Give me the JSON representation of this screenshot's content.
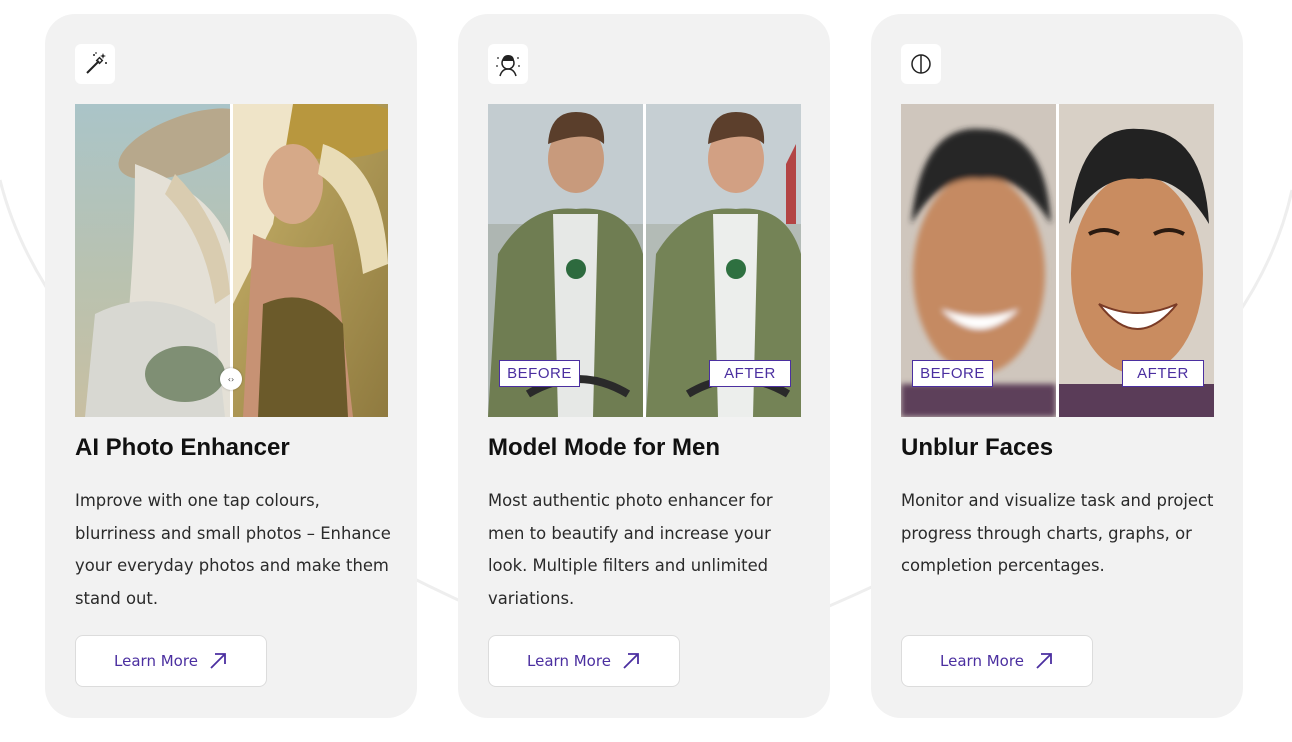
{
  "colors": {
    "card_bg": "#f2f2f2",
    "accent": "#4b2fa0",
    "title": "#111111",
    "text": "#2a2a2a"
  },
  "cards": [
    {
      "icon": "magic-wand-icon",
      "title": "AI Photo Enhancer",
      "description": "Improve with one tap colours, blurriness and small photos – Enhance your everyday photos and make them stand out.",
      "button_label": "Learn More",
      "button_icon": "arrow-up-right-icon",
      "compare_style": "slider",
      "slider_handle_glyph": "‹›"
    },
    {
      "icon": "man-portrait-icon",
      "title": "Model Mode for Men",
      "description": "Most authentic photo enhancer for men to beautify and increase your look. Multiple filters and unlimited variations.",
      "button_label": "Learn More",
      "button_icon": "arrow-up-right-icon",
      "before_label": "BEFORE",
      "after_label": "AFTER"
    },
    {
      "icon": "half-circle-icon",
      "title": "Unblur Faces",
      "description": "Monitor and visualize task and project progress through charts, graphs, or completion percentages.",
      "button_label": "Learn More",
      "button_icon": "arrow-up-right-icon",
      "before_label": "BEFORE",
      "after_label": "AFTER"
    }
  ]
}
